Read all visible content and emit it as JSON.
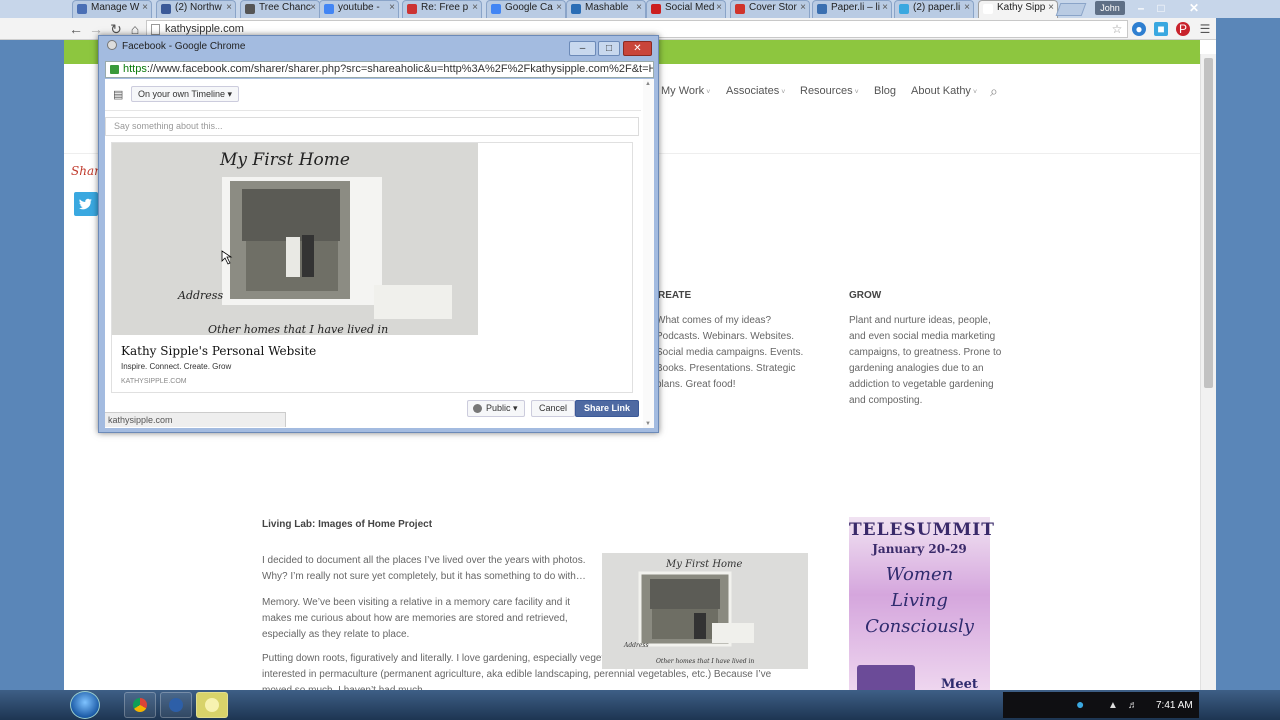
{
  "browser": {
    "tabs": [
      {
        "label": "Manage W",
        "icon_color": "#4a6fb5"
      },
      {
        "label": "(2) Northw",
        "icon_color": "#3b5998"
      },
      {
        "label": "Tree Chanc",
        "icon_color": "#555555"
      },
      {
        "label": "youtube - ",
        "icon_color": "#4285f4"
      },
      {
        "label": "Re: Free p",
        "icon_color": "#cc3333"
      },
      {
        "label": "Google Ca",
        "icon_color": "#4285f4"
      },
      {
        "label": "Mashable",
        "icon_color": "#2a6db5"
      },
      {
        "label": "Social Med",
        "icon_color": "#cc1f1f"
      },
      {
        "label": "Cover Stor",
        "icon_color": "#d0342c"
      },
      {
        "label": "Paper.li – li",
        "icon_color": "#3a6fb0"
      },
      {
        "label": "(2) paper.li",
        "icon_color": "#3aa8e0"
      },
      {
        "label": "Kathy Sipp",
        "icon_color": "#ffffff"
      }
    ],
    "user": "John",
    "url": "kathysipple.com",
    "window_controls": [
      "–",
      "□",
      "✕"
    ]
  },
  "site": {
    "nav": [
      {
        "label": "My Work",
        "caret": "˅"
      },
      {
        "label": "Associates",
        "caret": "˅"
      },
      {
        "label": "Resources",
        "caret": "˅"
      },
      {
        "label": "Blog",
        "caret": ""
      },
      {
        "label": "About Kathy",
        "caret": "˅"
      }
    ],
    "search_icon": "⌕",
    "share_script": "Shar",
    "columns": [
      {
        "heading": "REATE",
        "text": "What comes of my ideas? Podcasts. Webinars. Websites. Social media campaigns. Events. Books. Presentations.  Strategic plans. Great food!"
      },
      {
        "heading": "GROW",
        "text": "Plant and nurture ideas, people, and even social media marketing campaigns, to greatness. Prone to gardening analogies due to an addiction to vegetable gardening and composting."
      }
    ],
    "section_title": "Living Lab: Images of Home Project",
    "paragraphs": [
      "I decided to document all the places I’ve lived over the years with photos. Why? I’m really not sure yet completely, but it has something to do with…",
      "Memory. We’ve been visiting a relative in a memory care facility and it makes me curious about how are memories are stored and retrieved, especially as they relate to place.",
      "Putting down roots, figuratively and literally. I love gardening, especially vegetable gardening and am very interested in permaculture (permanent agriculture, aka edible landscaping, perennial vegetables, etc.) Because I’ve moved so much, I haven’t had much"
    ],
    "telesummit": {
      "title": "TELESUMMIT",
      "dates": "January 20-29",
      "line1": "Women",
      "line2": "Living",
      "line3": "Consciously",
      "meet": "Meet"
    }
  },
  "popup": {
    "window_title": "Facebook - Google Chrome",
    "url_https": "https",
    "url_rest": "://www.facebook.com/sharer/sharer.php?src=shareaholic&u=http%3A%2F%2Fkathysipple.com%2F&t=Ho",
    "audience": "On your own Timeline ▾",
    "say_placeholder": "Say something about this...",
    "link_title": "Kathy Sipple's Personal Website",
    "link_desc": "Inspire. Connect. Create. Grow",
    "link_domain": "KATHYSIPPLE.COM",
    "public_label": "Public ▾",
    "cancel_label": "Cancel",
    "share_label": "Share Link",
    "status_url": "kathysipple.com",
    "photo_caption_top": "My First Home",
    "photo_address": "Address",
    "photo_caption_bottom": "Other homes that I have lived in"
  },
  "taskbar": {
    "clock": "7:41 AM"
  },
  "colors": {
    "accent_green": "#8dc63f",
    "facebook_blue": "#4e69a2",
    "twitter_blue": "#3aa8e0"
  }
}
